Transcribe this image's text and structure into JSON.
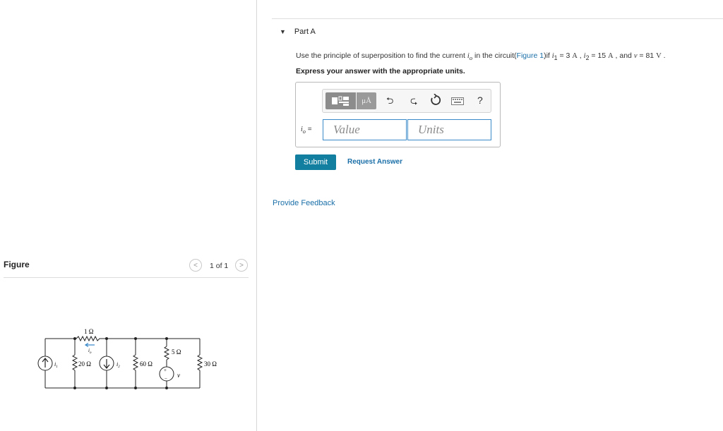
{
  "part": {
    "title": "Part A",
    "collapsed": false
  },
  "instruction": {
    "pre": "Use the principle of superposition to find the current ",
    "var_io": "i",
    "sub_o": "o",
    "mid1": " in the circuit(",
    "figure_link": "Figure 1",
    "mid2": ")if ",
    "var_i1": "i",
    "sub_1": "1",
    "eq1": " = 3 ",
    "unit_A1": "A",
    "sep1": " , ",
    "var_i2": "i",
    "sub_2": "2",
    "eq2": " = 15 ",
    "unit_A2": "A",
    "sep2": " , and ",
    "var_v": "v",
    "eq3": " = 81 ",
    "unit_V": "V",
    "end": " ."
  },
  "emphasis": "Express your answer with the appropriate units.",
  "toolbar": {
    "units_glyph": "μÅ",
    "icons": [
      "templates-icon",
      "units-icon",
      "undo-icon",
      "redo-icon",
      "reset-icon",
      "keyboard-icon",
      "help-icon"
    ],
    "help_label": "?"
  },
  "answer": {
    "lhs_var": "i",
    "lhs_sub": "o",
    "lhs_eq": " =",
    "value_placeholder": "Value",
    "units_placeholder": "Units"
  },
  "buttons": {
    "submit": "Submit",
    "request_answer": "Request Answer"
  },
  "provide_feedback": "Provide Feedback",
  "figure": {
    "label": "Figure",
    "pager": "1 of 1",
    "circuit_labels": {
      "r1": "1 Ω",
      "r20": "20 Ω",
      "r60": "60 Ω",
      "r5": "5 Ω",
      "r30": "30 Ω",
      "io": "i",
      "io_sub": "o",
      "i1": "i",
      "i1_sub": "1",
      "i2": "i",
      "i2_sub": "2",
      "v": "v",
      "plus": "+",
      "minus": "−"
    }
  },
  "colors": {
    "link": "#1a6fa8",
    "submit_bg": "#137fa0",
    "field_border": "#3a89c9"
  }
}
